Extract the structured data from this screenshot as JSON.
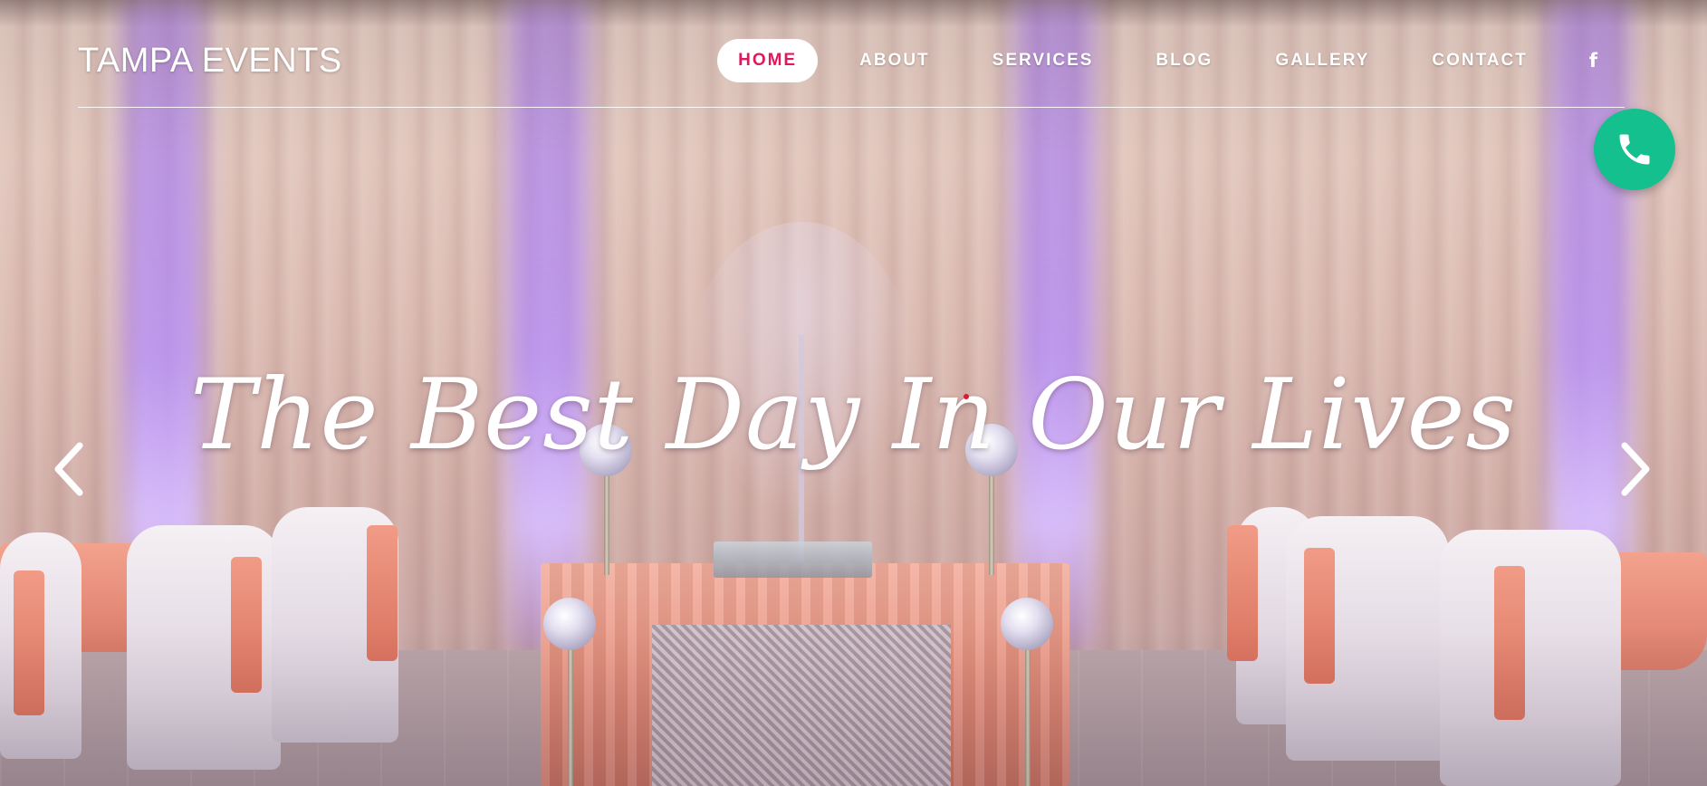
{
  "brand": {
    "name": "TAMPA EVENTS"
  },
  "nav": {
    "items": [
      {
        "label": "HOME",
        "active": true
      },
      {
        "label": "ABOUT",
        "active": false
      },
      {
        "label": "SERVICES",
        "active": false
      },
      {
        "label": "BLOG",
        "active": false
      },
      {
        "label": "GALLERY",
        "active": false
      },
      {
        "label": "CONTACT",
        "active": false
      }
    ],
    "facebook_icon": "f"
  },
  "hero": {
    "title": "The Best Day In Our Lives",
    "prev_icon": "chevron-left-icon",
    "next_icon": "chevron-right-icon"
  },
  "call_button": {
    "icon": "phone-icon",
    "color": "#14c08e"
  },
  "colors": {
    "accent": "#e0195e",
    "call": "#14c08e",
    "text": "#ffffff"
  }
}
